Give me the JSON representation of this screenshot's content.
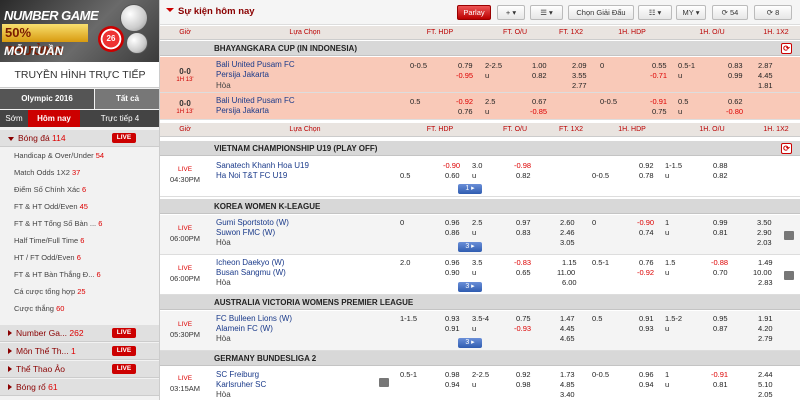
{
  "banner": {
    "line1": "NUMBER GAME",
    "line2": "50% THƯỞNG",
    "line3": "MỖI TUẦN",
    "chip": "26"
  },
  "sidebar": {
    "tv": "TRUYỀN HÌNH TRỰC TIẾP",
    "tab_a": "Olympic 2016",
    "tab_b": "Tất cả",
    "tab_c": "Sớm",
    "tab_d": "Hôm nay",
    "tab_e": "Trực tiếp 4",
    "football": {
      "label": "Bóng đá",
      "count": "114",
      "live": "LIVE"
    },
    "items": [
      {
        "label": "Handicap & Over/Under",
        "count": "54"
      },
      {
        "label": "Match Odds 1X2",
        "count": "37"
      },
      {
        "label": "Điểm Số Chính Xác",
        "count": "6"
      },
      {
        "label": "FT & HT Odd/Even",
        "count": "45"
      },
      {
        "label": "FT & HT Tổng Số Bàn ...",
        "count": "6"
      },
      {
        "label": "Half Time/Full Time",
        "count": "6"
      },
      {
        "label": "HT / FT Odd/Even",
        "count": "6"
      },
      {
        "label": "FT & HT Bàn Thắng Đ...",
        "count": "6"
      },
      {
        "label": "Cá cược tổng hợp",
        "count": "25"
      },
      {
        "label": "Cược thắng",
        "count": "60"
      }
    ],
    "others": [
      {
        "label": "Number Ga...",
        "count": "262",
        "live": "LIVE"
      },
      {
        "label": "Môn Thể Th...",
        "count": "1",
        "live": "LIVE"
      },
      {
        "label": "Thể Thao Ảo",
        "count": "",
        "live": "LIVE"
      },
      {
        "label": "Bóng rổ",
        "count": "61",
        "live": ""
      }
    ]
  },
  "toolbar": {
    "title": "Sự kiện hôm nay",
    "parlay": "Parlay",
    "plus": "+ ▾",
    "list": "☰ ▾",
    "choose": "Chọn Giải Đấu",
    "view": "☷ ▾",
    "odds": "MY ▾",
    "refresh1": "54",
    "refresh2": "8"
  },
  "headers": {
    "time": "Giờ",
    "choice": "Lựa Chọn",
    "ft_hdp": "FT. HDP",
    "ft_ou": "FT. O/U",
    "ft_1x2": "FT. 1X2",
    "h1_hdp": "1H. HDP",
    "h1_ou": "1H. O/U",
    "h1_1x2": "1H. 1X2"
  },
  "leagues": {
    "l1": "BHAYANGKARA CUP (IN INDONESIA)",
    "l2": "VIETNAM CHAMPIONSHIP U19 (PLAY OFF)",
    "l3": "KOREA WOMEN K-LEAGUE",
    "l4": "AUSTRALIA VICTORIA WOMENS PREMIER LEAGUE",
    "l5": "GERMANY BUNDESLIGA 2"
  },
  "live_text": "LIVE",
  "draw": "Hòa",
  "u": "u",
  "m1": {
    "score": "0-0",
    "ht": "1H 13'",
    "home": "Bali United Pusam FC",
    "away": "Persija Jakarta",
    "ft_line": "0-0.5",
    "ft_h": "0.79",
    "ft_a": "-0.95",
    "ou_line": "2-2.5",
    "ou_o": "1.00",
    "ou_u": "0.82",
    "x1": "2.09",
    "x2": "3.55",
    "xd": "2.77",
    "h1_line": "0",
    "h1_h": "0.55",
    "h1_a": "-0.71",
    "h1ou_line": "0.5-1",
    "h1ou_o": "0.83",
    "h1ou_u": "0.99",
    "hx1": "2.87",
    "hx2": "4.45",
    "hxd": "1.81"
  },
  "m2": {
    "score": "0-0",
    "ht": "1H 13'",
    "home": "Bali United Pusam FC",
    "away": "Persija Jakarta",
    "ft_line": "0.5",
    "ft_h": "-0.92",
    "ft_a": "0.76",
    "ou_line": "2.5",
    "ou_o": "0.67",
    "ou_u": "-0.85",
    "h1_line": "0-0.5",
    "h1_h": "-0.91",
    "h1_a": "0.75",
    "h1ou_line": "0.5",
    "h1ou_o": "0.62",
    "h1ou_u": "-0.80"
  },
  "m3": {
    "time": "04:30PM",
    "home": "Sanatech Khanh Hoa U19",
    "away": "Ha Noi T&T FC U19",
    "ft_line": "0.5",
    "ft_h": "-0.90",
    "ft_a": "0.60",
    "ou_line": "3.0",
    "ou_o": "-0.98",
    "ou_u": "0.82",
    "h1_line": "0-0.5",
    "h1_h": "0.92",
    "h1_a": "0.78",
    "h1ou_line": "1-1.5",
    "h1ou_o": "0.88",
    "h1ou_u": "0.82",
    "more": "1 ▸"
  },
  "m4": {
    "time": "06:00PM",
    "home": "Gumi Sportstoto (W)",
    "away": "Suwon FMC (W)",
    "ft_line": "0",
    "ft_h": "0.96",
    "ft_a": "0.86",
    "ou_line": "2.5",
    "ou_o": "0.97",
    "ou_u": "0.83",
    "x1": "2.60",
    "x2": "2.46",
    "xd": "3.05",
    "h1_line": "0",
    "h1_h": "-0.90",
    "h1_a": "0.74",
    "h1ou_line": "1",
    "h1ou_o": "0.99",
    "h1ou_u": "0.81",
    "hx1": "3.50",
    "hx2": "2.90",
    "hxd": "2.03",
    "more": "3 ▸"
  },
  "m5": {
    "time": "06:00PM",
    "home": "Icheon Daekyo (W)",
    "away": "Busan Sangmu (W)",
    "ft_line": "2.0",
    "ft_h": "0.96",
    "ft_a": "0.90",
    "ou_line": "3.5",
    "ou_o": "-0.83",
    "ou_u": "0.65",
    "x1": "1.15",
    "x2": "11.00",
    "xd": "6.00",
    "h1_line": "0.5-1",
    "h1_h": "0.76",
    "h1_a": "-0.92",
    "h1ou_line": "1.5",
    "h1ou_o": "-0.88",
    "h1ou_u": "0.70",
    "hx1": "1.49",
    "hx2": "10.00",
    "hxd": "2.83",
    "more": "3 ▸"
  },
  "m6": {
    "time": "05:30PM",
    "home": "FC Bulleen Lions (W)",
    "away": "Alamein FC (W)",
    "ft_line": "1-1.5",
    "ft_h": "0.93",
    "ft_a": "0.91",
    "ou_line": "3.5-4",
    "ou_o": "0.75",
    "ou_u": "-0.93",
    "x1": "1.47",
    "x2": "4.45",
    "xd": "4.65",
    "h1_line": "0.5",
    "h1_h": "0.91",
    "h1_a": "0.93",
    "h1ou_line": "1.5-2",
    "h1ou_o": "0.95",
    "h1ou_u": "0.87",
    "hx1": "1.91",
    "hx2": "4.20",
    "hxd": "2.79",
    "more": "3 ▸"
  },
  "m7": {
    "time": "03:15AM",
    "home": "SC Freiburg",
    "away": "Karlsruher SC",
    "ft_line": "0.5-1",
    "ft_h": "0.98",
    "ft_a": "0.94",
    "ou_line": "2-2.5",
    "ou_o": "0.92",
    "ou_u": "0.98",
    "x1": "1.73",
    "x2": "4.85",
    "xd": "3.40",
    "h1_line": "0-0.5",
    "h1_h": "0.96",
    "h1_a": "0.94",
    "h1ou_line": "1",
    "h1ou_o": "-0.91",
    "h1ou_u": "0.81",
    "hx1": "2.44",
    "hx2": "5.10",
    "hxd": "2.05"
  }
}
